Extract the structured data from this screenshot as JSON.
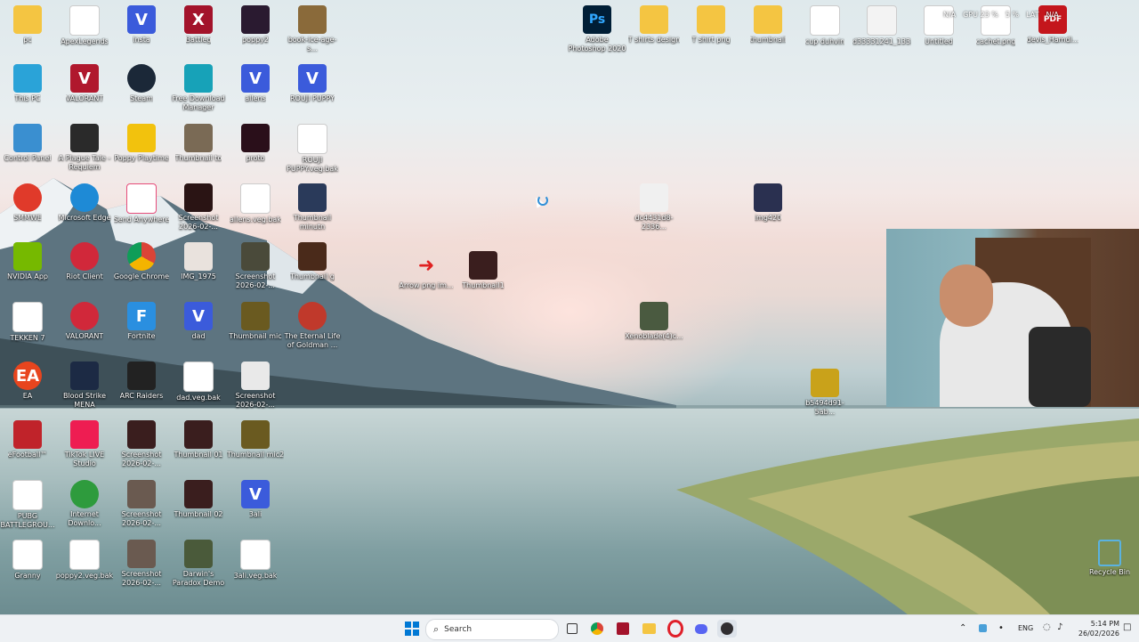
{
  "desktop": {
    "icons": [
      {
        "label": "pc"
      },
      {
        "label": "ApexLegends"
      },
      {
        "label": "Insta"
      },
      {
        "label": "Battleg"
      },
      {
        "label": "poppy2"
      },
      {
        "label": "book-ice-age-s..."
      },
      {
        "label": "This PC"
      },
      {
        "label": "VALORANT"
      },
      {
        "label": "Steam"
      },
      {
        "label": "Free Download Manager"
      },
      {
        "label": "allens"
      },
      {
        "label": "ROUJI PUPPY"
      },
      {
        "label": "Control Panel"
      },
      {
        "label": "A Plague Tale - Requiem"
      },
      {
        "label": "Poppy Playtime"
      },
      {
        "label": "Thumbnail to"
      },
      {
        "label": "proto"
      },
      {
        "label": "ROUJI PUPPY.veg.bak"
      },
      {
        "label": "SMMWE"
      },
      {
        "label": "Microsoft Edge"
      },
      {
        "label": "Send Anywhere"
      },
      {
        "label": "Screenshot 2026-02-..."
      },
      {
        "label": "allens.veg.bak"
      },
      {
        "label": "Thumbnail minutn"
      },
      {
        "label": "NVIDIA App"
      },
      {
        "label": "Riot Client"
      },
      {
        "label": "Google Chrome"
      },
      {
        "label": "IMG_1975"
      },
      {
        "label": "Screenshot 2026-02-..."
      },
      {
        "label": "Thumbnail g"
      },
      {
        "label": "TEKKEN 7"
      },
      {
        "label": "VALORANT"
      },
      {
        "label": "Fortnite"
      },
      {
        "label": "dad"
      },
      {
        "label": "Thumbnail mic"
      },
      {
        "label": "The Eternal Life of Goldman ..."
      },
      {
        "label": "EA"
      },
      {
        "label": "Blood Strike MENA"
      },
      {
        "label": "ARC Raiders"
      },
      {
        "label": "dad.veg.bak"
      },
      {
        "label": "Screenshot 2026-02-..."
      },
      {
        "label": "eFootball™"
      },
      {
        "label": "TikTok LIVE Studio"
      },
      {
        "label": "Screenshot 2026-02-..."
      },
      {
        "label": "Thumbnail 01"
      },
      {
        "label": "Thumbnail mic2"
      },
      {
        "label": "PUBG BATTLEGROU..."
      },
      {
        "label": "Internet Downlo..."
      },
      {
        "label": "Screenshot 2026-02-..."
      },
      {
        "label": "Thumbnail 02"
      },
      {
        "label": "3ali"
      },
      {
        "label": "Granny"
      },
      {
        "label": "poppy2.veg.bak"
      },
      {
        "label": "Screenshot 2026-02-..."
      },
      {
        "label": "Darwin's Paradox Demo"
      },
      {
        "label": "3ali.veg.bak"
      },
      {
        "label": "Arrow png im..."
      },
      {
        "label": "Thumbnail1"
      },
      {
        "label": "Adobe Photoshop 2020"
      },
      {
        "label": "T shirts design"
      },
      {
        "label": "T shirt png"
      },
      {
        "label": "thumbnail"
      },
      {
        "label": "cup duhvin"
      },
      {
        "label": "d33331241_133..."
      },
      {
        "label": "Untitled"
      },
      {
        "label": "cachet.png"
      },
      {
        "label": "devis_Hamdi..."
      },
      {
        "label": "dc4431d8-2336..."
      },
      {
        "label": "img420"
      },
      {
        "label": "Xenoblade(4)c..."
      },
      {
        "label": "b5494d91-5ab..."
      },
      {
        "label": "Recycle Bin"
      }
    ]
  },
  "overlay": {
    "gpu_text": "GPU 23 %",
    "cpu_text": "N/A",
    "lat_text": "LAT",
    "lat_val": "N/A",
    "na2": "N/A",
    "pct": "5 %"
  },
  "taskbar": {
    "search_placeholder": "Search",
    "lang": "ENG",
    "time": "5:14 PM",
    "date": "26/02/2026"
  },
  "colors": {
    "accent": "#0067c0"
  }
}
